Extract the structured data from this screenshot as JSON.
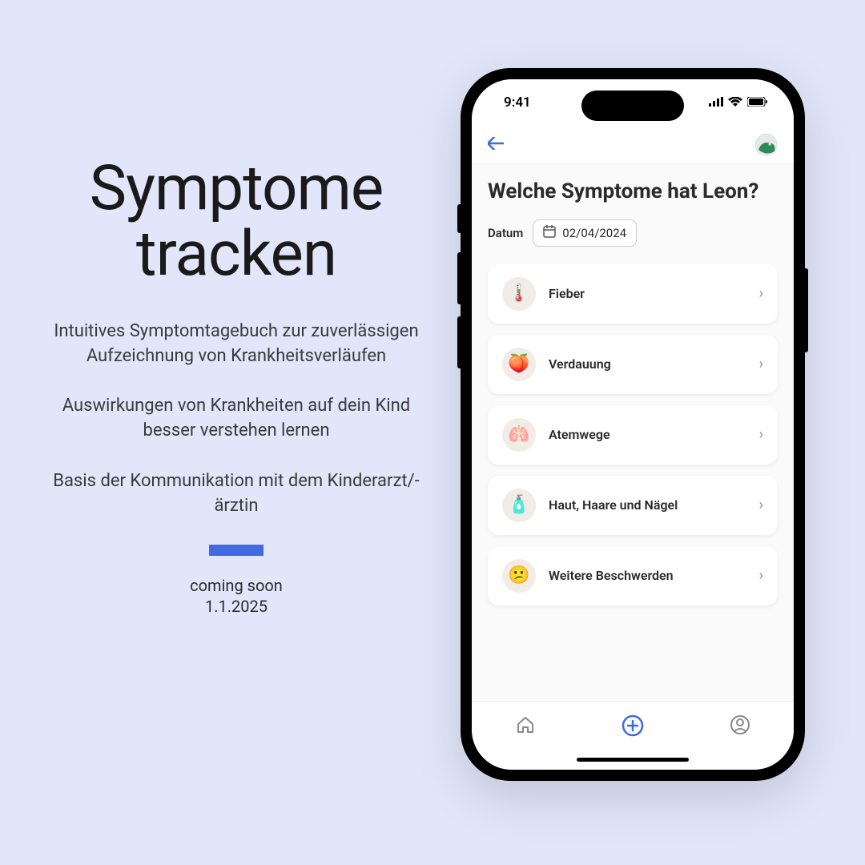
{
  "promo": {
    "title_line1": "Symptome",
    "title_line2": "tracken",
    "desc1": "Intuitives Symptomtagebuch zur zuverlässigen Aufzeichnung von Krankheitsverläufen",
    "desc2": "Auswirkungen von Krankheiten auf dein Kind besser verstehen lernen",
    "desc3": "Basis der Kommunikation mit dem Kinderarzt/-ärztin",
    "coming_soon": "coming soon",
    "release_date": "1.1.2025"
  },
  "status": {
    "time": "9:41"
  },
  "screen": {
    "title": "Welche Symptome hat Leon?",
    "date_label": "Datum",
    "date_value": "02/04/2024"
  },
  "symptoms": [
    {
      "icon": "🌡️",
      "label": "Fieber"
    },
    {
      "icon": "🍑",
      "label": "Verdauung"
    },
    {
      "icon": "🫁",
      "label": "Atemwege"
    },
    {
      "icon": "🧴",
      "label": "Haut, Haare und Nägel"
    },
    {
      "icon": "😕",
      "label": "Weitere Beschwerden"
    }
  ]
}
